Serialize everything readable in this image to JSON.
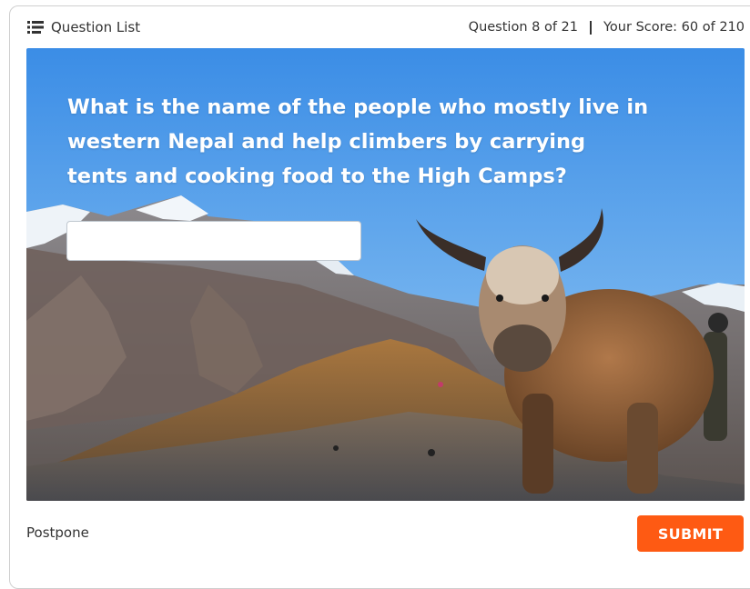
{
  "header": {
    "question_list_label": "Question List",
    "question_progress": "Question 8 of 21",
    "score": "Your Score: 60 of 210"
  },
  "quiz": {
    "question_text": "What is the name of the people who mostly live in western Nepal and help climbers by carrying tents and cooking food to the High Camps?",
    "answer_value": "",
    "answer_placeholder": ""
  },
  "footer": {
    "postpone_label": "Postpone",
    "submit_label": "SUBMIT"
  },
  "theme": {
    "accent": "#fe5a13",
    "sky_top": "#3e8fe6",
    "sky_bottom": "#8cc6f2"
  },
  "icons": {
    "question_list": "list-icon"
  }
}
